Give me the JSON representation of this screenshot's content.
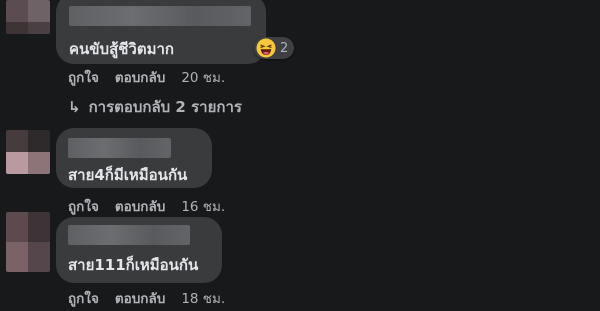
{
  "comments": [
    {
      "text": "คนขับสู้ชีวิตมาก",
      "like_label": "ถูกใจ",
      "reply_label": "ตอบกลับ",
      "time": "20 ชม.",
      "reaction": {
        "icon": "haha-emoji-icon",
        "count": "2"
      },
      "replies_link": "การตอบกลับ 2 รายการ"
    },
    {
      "text": "สาย4ก็มีเหมือนกัน",
      "like_label": "ถูกใจ",
      "reply_label": "ตอบกลับ",
      "time": "16 ชม."
    },
    {
      "text": "สาย111ก็เหมือนกัน",
      "like_label": "ถูกใจ",
      "reply_label": "ตอบกลับ",
      "time": "18 ชม."
    }
  ],
  "colors": {
    "background": "#18191a",
    "bubble": "#3a3b3c",
    "text": "#e4e6eb",
    "secondary_text": "#b0b3b8"
  }
}
